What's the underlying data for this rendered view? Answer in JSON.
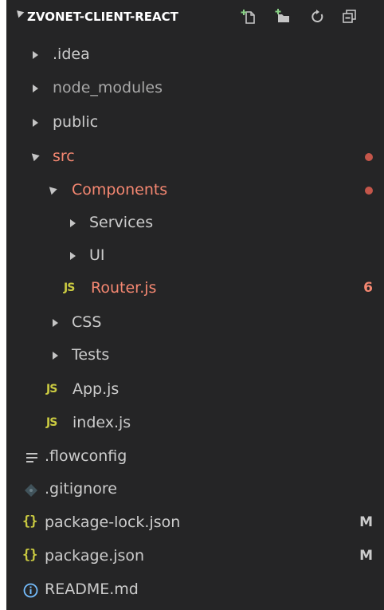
{
  "explorer": {
    "title": "ZVONET-CLIENT-REACT",
    "header_actions": [
      "new-file-icon",
      "new-folder-icon",
      "refresh-icon",
      "collapse-all-icon"
    ],
    "items": [
      {
        "label": ".idea",
        "kind": "folder",
        "expanded": false
      },
      {
        "label": "node_modules",
        "kind": "folder",
        "expanded": false
      },
      {
        "label": "public",
        "kind": "folder",
        "expanded": false
      },
      {
        "label": "src",
        "kind": "folder",
        "expanded": true,
        "modified": true
      },
      {
        "label": "Components",
        "kind": "folder",
        "expanded": true,
        "modified": true
      },
      {
        "label": "Services",
        "kind": "folder",
        "expanded": false
      },
      {
        "label": "UI",
        "kind": "folder",
        "expanded": false
      },
      {
        "label": "Router.js",
        "kind": "js-file",
        "icon_text": "JS",
        "badge": "6"
      },
      {
        "label": "CSS",
        "kind": "folder",
        "expanded": false
      },
      {
        "label": "Tests",
        "kind": "folder",
        "expanded": false
      },
      {
        "label": "App.js",
        "kind": "js-file",
        "icon_text": "JS"
      },
      {
        "label": "index.js",
        "kind": "js-file",
        "icon_text": "JS"
      },
      {
        "label": ".flowconfig",
        "kind": "config-file"
      },
      {
        "label": ".gitignore",
        "kind": "git-file"
      },
      {
        "label": "package-lock.json",
        "kind": "json-file",
        "icon_text": "{}",
        "badge": "M"
      },
      {
        "label": "package.json",
        "kind": "json-file",
        "icon_text": "{}",
        "badge": "M"
      },
      {
        "label": "README.md",
        "kind": "info-file"
      }
    ]
  },
  "colors": {
    "background": "#252526",
    "text": "#cccccc",
    "modified": "#f48771",
    "modified_dot": "#c4564a",
    "js_icon": "#cbcb41",
    "icon_gray": "#c5c5c5",
    "info_blue": "#75beff"
  }
}
